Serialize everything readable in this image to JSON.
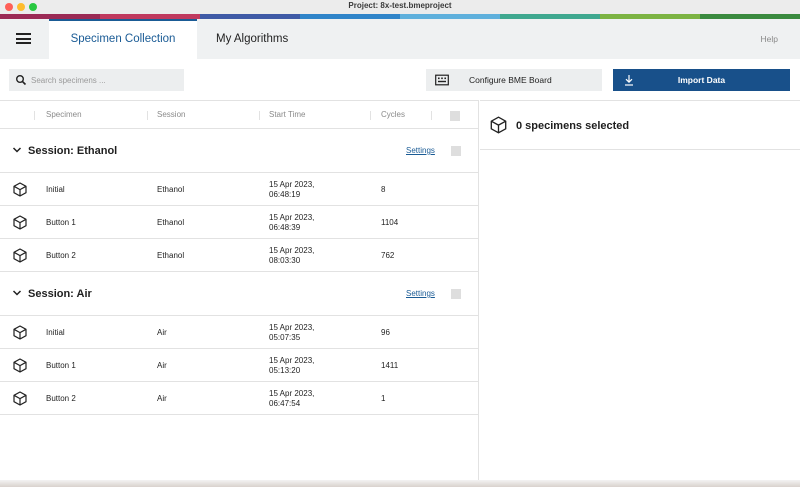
{
  "window": {
    "title": "Project: 8x-test.bmeproject",
    "brand_colors": [
      "#9b2a55",
      "#c0395e",
      "#3f5aa6",
      "#2f84c9",
      "#5fb0dc",
      "#3fa88f",
      "#7cb342",
      "#3a8a3f"
    ]
  },
  "nav": {
    "tabs": [
      {
        "label": "Specimen Collection",
        "active": true
      },
      {
        "label": "My Algorithms",
        "active": false
      }
    ],
    "help_label": "Help",
    "accent_color": "#1a5b95"
  },
  "toolbar": {
    "search_placeholder": "Search specimens ...",
    "configure_label": "Configure BME Board",
    "import_label": "Import Data",
    "import_color": "#18508a"
  },
  "table": {
    "headers": [
      "Specimen",
      "Session",
      "Start Time",
      "Cycles"
    ],
    "groups": [
      {
        "title": "Session: Ethanol",
        "settings_label": "Settings",
        "rows": [
          {
            "specimen": "Initial",
            "session": "Ethanol",
            "date": "15 Apr 2023,",
            "time": "06:48:19",
            "cycles": "8"
          },
          {
            "specimen": "Button 1",
            "session": "Ethanol",
            "date": "15 Apr 2023,",
            "time": "06:48:39",
            "cycles": "1104"
          },
          {
            "specimen": "Button 2",
            "session": "Ethanol",
            "date": "15 Apr 2023,",
            "time": "08:03:30",
            "cycles": "762"
          }
        ]
      },
      {
        "title": "Session: Air",
        "settings_label": "Settings",
        "rows": [
          {
            "specimen": "Initial",
            "session": "Air",
            "date": "15 Apr 2023,",
            "time": "05:07:35",
            "cycles": "96"
          },
          {
            "specimen": "Button 1",
            "session": "Air",
            "date": "15 Apr 2023,",
            "time": "05:13:20",
            "cycles": "1411"
          },
          {
            "specimen": "Button 2",
            "session": "Air",
            "date": "15 Apr 2023,",
            "time": "06:47:54",
            "cycles": "1"
          }
        ]
      }
    ]
  },
  "detail": {
    "selected_text": "0 specimens selected"
  }
}
